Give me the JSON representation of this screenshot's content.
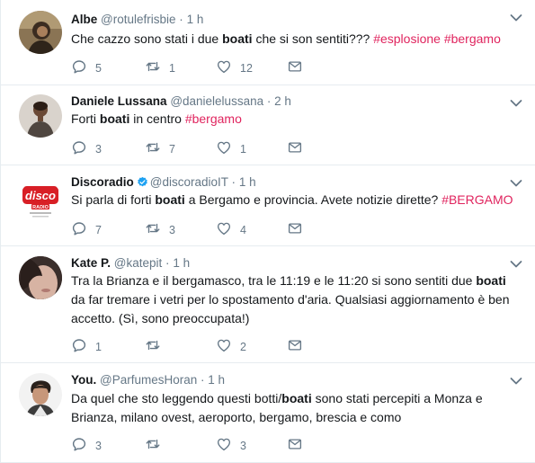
{
  "tweets": [
    {
      "name": "Albe",
      "handle": "@rotulefrisbie",
      "dot": "·",
      "time": "1 h",
      "text": [
        {
          "t": "Che cazzo sono stati i due ",
          "s": "n"
        },
        {
          "t": "boati",
          "s": "b"
        },
        {
          "t": " che si son sentiti??? ",
          "s": "n"
        },
        {
          "t": "#esplosione",
          "s": "h"
        },
        {
          "t": " ",
          "s": "n"
        },
        {
          "t": "#bergamo",
          "s": "h"
        }
      ],
      "replies": "5",
      "retweets": "1",
      "likes": "12",
      "avatar": "avatar-albe"
    },
    {
      "name": "Daniele Lussana",
      "handle": "@danielelussana",
      "dot": "·",
      "time": "2 h",
      "text": [
        {
          "t": "Forti ",
          "s": "n"
        },
        {
          "t": "boati",
          "s": "b"
        },
        {
          "t": " in centro ",
          "s": "n"
        },
        {
          "t": "#bergamo",
          "s": "h"
        }
      ],
      "replies": "3",
      "retweets": "7",
      "likes": "1",
      "avatar": "avatar-daniele"
    },
    {
      "name": "Discoradio",
      "handle": "@discoradioIT",
      "dot": "·",
      "time": "1 h",
      "verified": true,
      "text": [
        {
          "t": "Si parla di forti ",
          "s": "n"
        },
        {
          "t": "boati",
          "s": "b"
        },
        {
          "t": " a Bergamo e provincia. Avete notizie dirette? ",
          "s": "n"
        },
        {
          "t": "#BERGAMO",
          "s": "h"
        }
      ],
      "replies": "7",
      "retweets": "3",
      "likes": "4",
      "avatar": "avatar-discoradio",
      "logo_text": "disco",
      "logo_sub": "RADIO"
    },
    {
      "name": "Kate P.",
      "handle": "@katepit",
      "dot": "·",
      "time": "1 h",
      "text": [
        {
          "t": "Tra la Brianza e il bergamasco, tra le 11:19 e le 11:20 si sono sentiti due ",
          "s": "n"
        },
        {
          "t": "boati",
          "s": "b"
        },
        {
          "t": " da far tremare i vetri per lo spostamento d'aria. Qualsiasi aggiornamento è ben accetto. (Sì, sono preoccupata!)",
          "s": "n"
        }
      ],
      "replies": "1",
      "retweets": "",
      "likes": "2",
      "avatar": "avatar-kate"
    },
    {
      "name": "You.",
      "handle": "@ParfumesHoran",
      "dot": "·",
      "time": "1 h",
      "text": [
        {
          "t": "Da quel che sto leggendo questi botti/",
          "s": "n"
        },
        {
          "t": "boati",
          "s": "b"
        },
        {
          "t": " sono stati percepiti a Monza e Brianza, milano ovest, aeroporto, bergamo, brescia e como",
          "s": "n"
        }
      ],
      "replies": "3",
      "retweets": "",
      "likes": "3",
      "avatar": "avatar-you"
    }
  ],
  "colors": {
    "hashtag": "#e0245e",
    "icon": "#657786",
    "verified": "#1da1f2",
    "divider": "#e6ecf0"
  },
  "icons": [
    "reply-icon",
    "retweet-icon",
    "like-icon",
    "direct-message-icon",
    "chevron-down-icon",
    "verified-badge-icon"
  ]
}
